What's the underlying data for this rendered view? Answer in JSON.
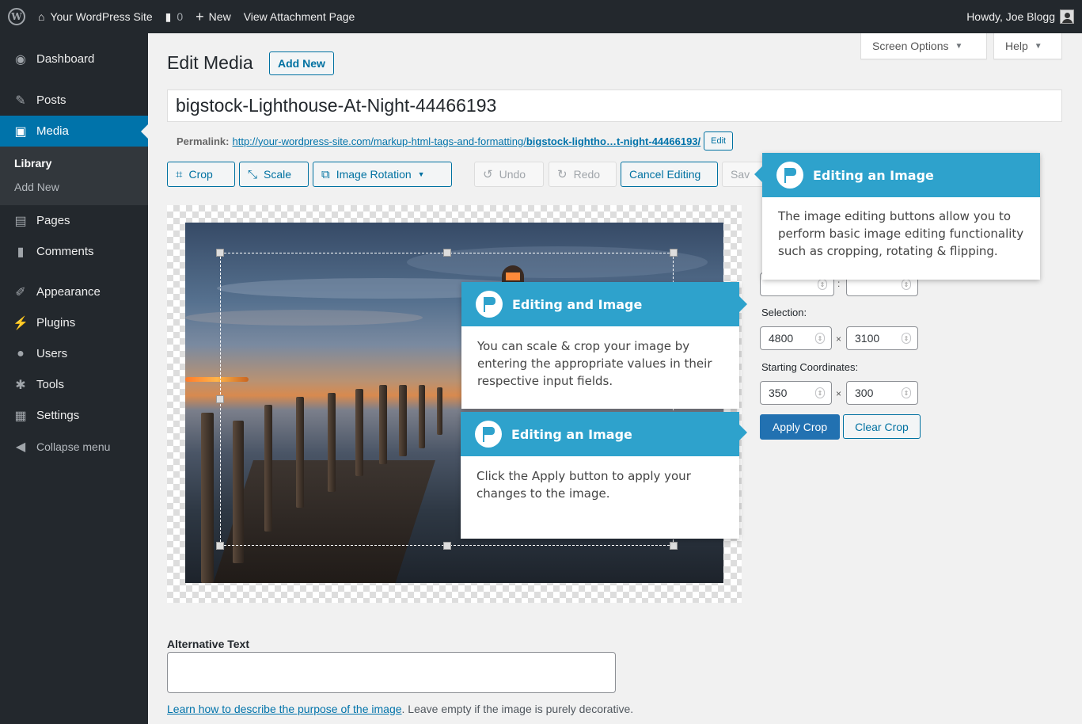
{
  "adminbar": {
    "site_name": "Your WordPress Site",
    "comments_count": "0",
    "new_label": "New",
    "view_label": "View Attachment Page",
    "howdy": "Howdy, Joe Blogg"
  },
  "sidebar": {
    "items": [
      {
        "label": "Dashboard",
        "icon": "dashboard-icon"
      },
      {
        "label": "Posts",
        "icon": "pin-icon"
      },
      {
        "label": "Media",
        "icon": "media-icon"
      },
      {
        "label": "Pages",
        "icon": "page-icon"
      },
      {
        "label": "Comments",
        "icon": "comment-icon"
      },
      {
        "label": "Appearance",
        "icon": "brush-icon"
      },
      {
        "label": "Plugins",
        "icon": "plug-icon"
      },
      {
        "label": "Users",
        "icon": "user-icon"
      },
      {
        "label": "Tools",
        "icon": "wrench-icon"
      },
      {
        "label": "Settings",
        "icon": "settings-icon"
      },
      {
        "label": "Collapse menu",
        "icon": "collapse-icon"
      }
    ],
    "media_submenu": [
      "Library",
      "Add New"
    ]
  },
  "screen_meta": {
    "screen_options": "Screen Options",
    "help": "Help"
  },
  "header": {
    "title": "Edit Media",
    "add_new": "Add New"
  },
  "post_title": "bigstock-Lighthouse-At-Night-44466193",
  "permalink": {
    "label": "Permalink:",
    "url_base": "http://your-wordpress-site.com/markup-html-tags-and-formatting/",
    "url_slug": "bigstock-lightho…t-night-44466193/",
    "edit": "Edit"
  },
  "toolbar": {
    "crop": "Crop",
    "scale": "Scale",
    "rotation": "Image Rotation",
    "undo": "Undo",
    "redo": "Redo",
    "cancel": "Cancel Editing",
    "save": "Sav"
  },
  "crop_panel": {
    "selection_label": "Selection:",
    "selection_w": "4800",
    "selection_h": "3100",
    "coords_label": "Starting Coordinates:",
    "coord_x": "350",
    "coord_y": "300",
    "times": "×",
    "apply": "Apply Crop",
    "clear": "Clear Crop"
  },
  "alt": {
    "label": "Alternative Text",
    "value": "",
    "help_link": "Learn how to describe the purpose of the image",
    "help_rest": ". Leave empty if the image is purely decorative."
  },
  "pointers": [
    {
      "title": "Editing an Image",
      "body": "The image editing buttons allow you to perform basic image editing functionality such as cropping, rotating & flipping."
    },
    {
      "title": "Editing and Image",
      "body": "You can scale & crop your image by entering the appropriate values in their respective input fields."
    },
    {
      "title": "Editing an Image",
      "body": "Click the Apply button to apply your changes to the image."
    }
  ],
  "colors": {
    "accent": "#0073aa",
    "pointer_header": "#2ea2cc",
    "adminbar": "#23282d"
  }
}
